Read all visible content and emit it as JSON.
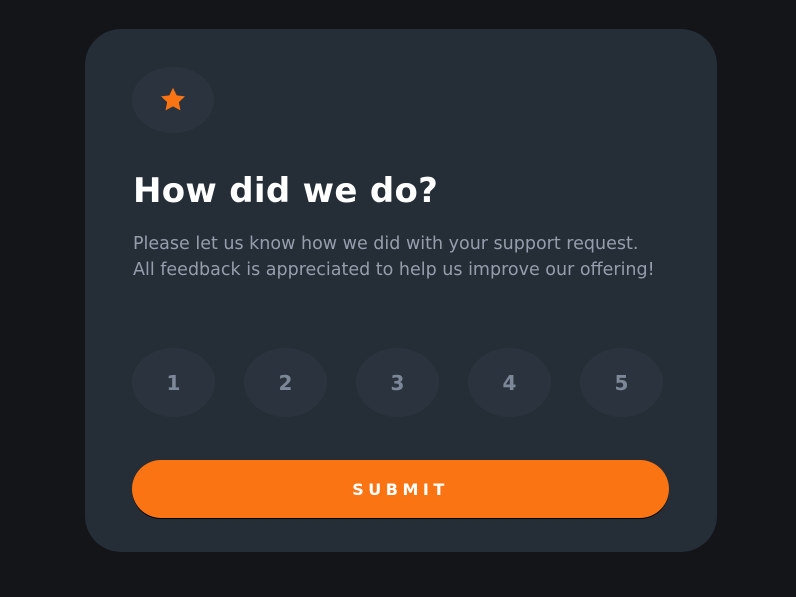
{
  "card": {
    "icon": "star-icon",
    "title": "How did we do?",
    "description": "Please let us know how we did with your support request. All feedback is appreciated to help us improve our offering!",
    "ratings": [
      "1",
      "2",
      "3",
      "4",
      "5"
    ],
    "submit_label": "SUBMIT"
  },
  "colors": {
    "page_background": "#131518",
    "card_background": "#252d37",
    "circle_background": "#2b333e",
    "accent_orange": "#fb7413",
    "title_text": "#ffffff",
    "body_text": "#959eac",
    "rating_text": "#7c8798"
  }
}
